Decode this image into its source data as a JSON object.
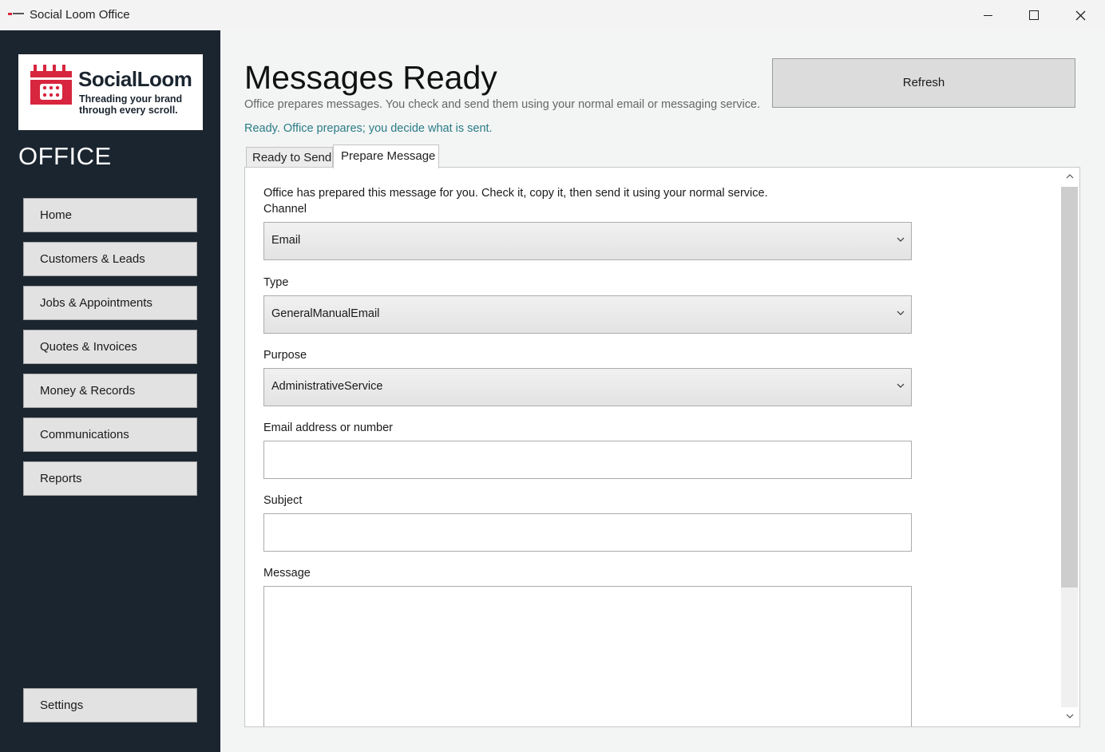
{
  "window": {
    "title": "Social Loom Office"
  },
  "sidebar": {
    "logo": {
      "name": "SocialLoom",
      "tagline": "Threading your brand through every scroll."
    },
    "section_label": "OFFICE",
    "items": [
      {
        "label": "Home"
      },
      {
        "label": "Customers & Leads"
      },
      {
        "label": "Jobs & Appointments"
      },
      {
        "label": "Quotes & Invoices"
      },
      {
        "label": "Money & Records"
      },
      {
        "label": "Communications"
      },
      {
        "label": "Reports"
      }
    ],
    "settings_label": "Settings"
  },
  "header": {
    "title": "Messages Ready",
    "subtitle": "Office prepares messages. You check and send them using your normal email or messaging service.",
    "status": "Ready. Office prepares; you decide what is sent.",
    "refresh_label": "Refresh"
  },
  "tabs": [
    {
      "label": "Ready to Send",
      "active": false
    },
    {
      "label": "Prepare Message",
      "active": true
    }
  ],
  "form": {
    "intro": "Office has prepared this message for you. Check it, copy it, then send it using your normal service.",
    "channel": {
      "label": "Channel",
      "value": "Email"
    },
    "type": {
      "label": "Type",
      "value": "GeneralManualEmail"
    },
    "purpose": {
      "label": "Purpose",
      "value": "AdministrativeService"
    },
    "address": {
      "label": "Email address or number",
      "value": ""
    },
    "subject": {
      "label": "Subject",
      "value": ""
    },
    "message": {
      "label": "Message",
      "value": ""
    }
  },
  "colors": {
    "sidebar_bg": "#1b2530",
    "brand_red": "#d7263d",
    "status_teal": "#2a7d87"
  },
  "icons": [
    "app-icon",
    "minimize-icon",
    "maximize-icon",
    "close-icon",
    "calendar-logo-icon",
    "chevron-down-icon",
    "scroll-up-icon",
    "scroll-down-icon"
  ]
}
